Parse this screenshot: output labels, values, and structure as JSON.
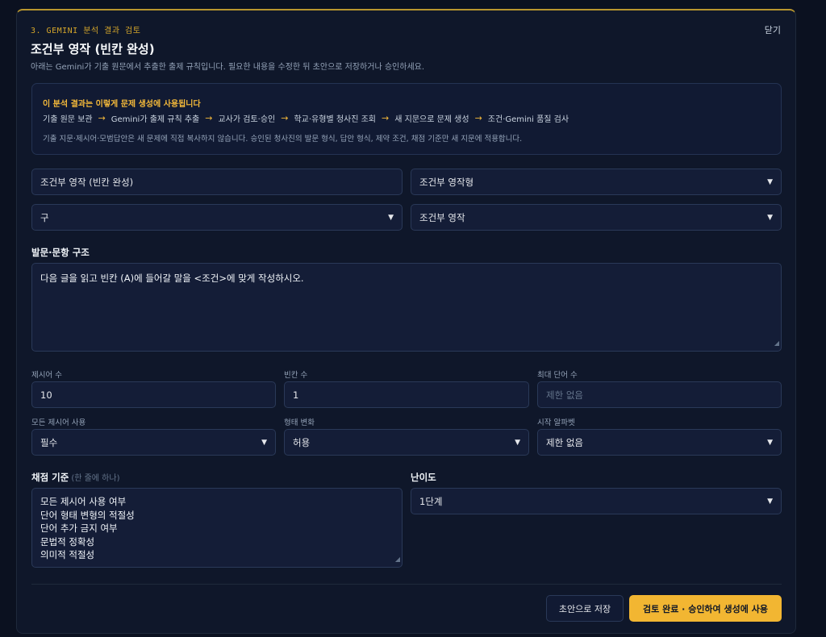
{
  "header": {
    "step_label": "3. GEMINI 분석 결과 검토",
    "close_label": "닫기",
    "title": "조건부 영작 (빈칸 완성)",
    "subtitle": "아래는 Gemini가 기출 원문에서 추출한 출제 규칙입니다. 필요한 내용을 수정한 뒤 초안으로 저장하거나 승인하세요."
  },
  "info": {
    "title": "이 분석 결과는 이렇게 문제 생성에 사용됩니다",
    "flow": [
      "기출 원문 보관",
      "Gemini가 출제 규칙 추출",
      "교사가 검토·승인",
      "학교·유형별 청사진 조회",
      "새 지문으로 문제 생성",
      "조건·Gemini 품질 검사"
    ],
    "note": "기출 지문·제시어·모범답안은 새 문제에 직접 복사하지 않습니다. 승인된 청사진의 발문 형식, 답안 형식, 제약 조건, 채점 기준만 새 지문에 적용합니다."
  },
  "form": {
    "name_value": "조건부 영작 (빈칸 완성)",
    "category_value": "조건부 영작형",
    "unit_value": "구",
    "type_value": "조건부 영작",
    "prompt_label": "발문·문항 구조",
    "prompt_value": "다음 글을 읽고 빈칸 (A)에 들어갈 말을 <조건>에 맞게 작성하시오.",
    "word_count_label": "제시어 수",
    "word_count_value": "10",
    "blank_count_label": "빈칸 수",
    "blank_count_value": "1",
    "max_words_label": "최대 단어 수",
    "max_words_placeholder": "제한 없음",
    "use_all_label": "모든 제시어 사용",
    "use_all_value": "필수",
    "form_change_label": "형태 변화",
    "form_change_value": "허용",
    "start_letter_label": "시작 알파벳",
    "start_letter_value": "제한 없음",
    "criteria_label": "채점 기준",
    "criteria_hint": "(한 줄에 하나)",
    "criteria": [
      "모든 제시어 사용 여부",
      "단어 형태 변형의 적절성",
      "단어 추가 금지 여부",
      "문법적 정확성",
      "의미적 적절성"
    ],
    "difficulty_label": "난이도",
    "difficulty_value": "1단계"
  },
  "actions": {
    "draft_label": "초안으로 저장",
    "approve_label": "검토 완료 · 승인하여 생성에 사용"
  },
  "colors": {
    "accent": "#f2b632",
    "background": "#0b1120",
    "panel": "#0f172a"
  }
}
